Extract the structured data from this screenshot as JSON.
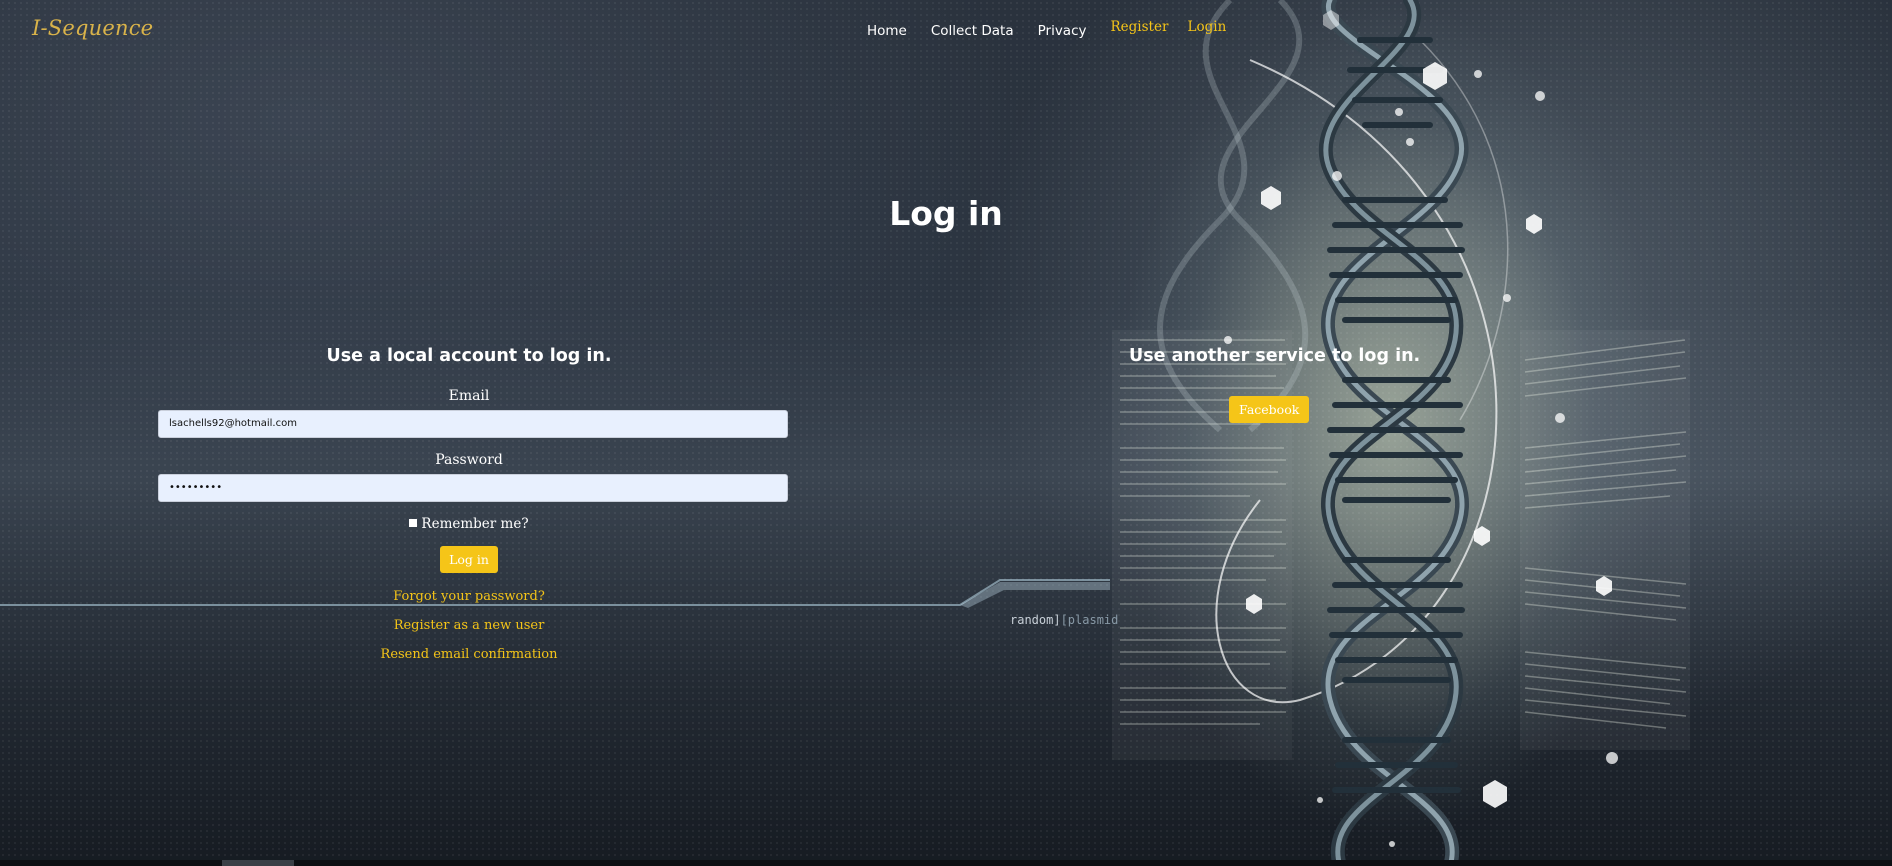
{
  "brand": "I-Sequence",
  "nav": {
    "home": "Home",
    "collect": "Collect Data",
    "privacy": "Privacy",
    "register": "Register",
    "login": "Login"
  },
  "page_title": "Log in",
  "local": {
    "heading": "Use a local account to log in.",
    "email_label": "Email",
    "email_value": "lsachells92@hotmail.com",
    "password_label": "Password",
    "password_value": "•••••••••",
    "remember_label": "Remember me?",
    "login_button": "Log in",
    "forgot": "Forgot your password?",
    "register": "Register as a new user",
    "resend": "Resend email confirmation"
  },
  "external": {
    "heading": "Use another service to log in.",
    "facebook": "Facebook"
  },
  "background": {
    "caption_a": "random]",
    "caption_b": "[plasmid",
    "accent": "#f5c518"
  }
}
